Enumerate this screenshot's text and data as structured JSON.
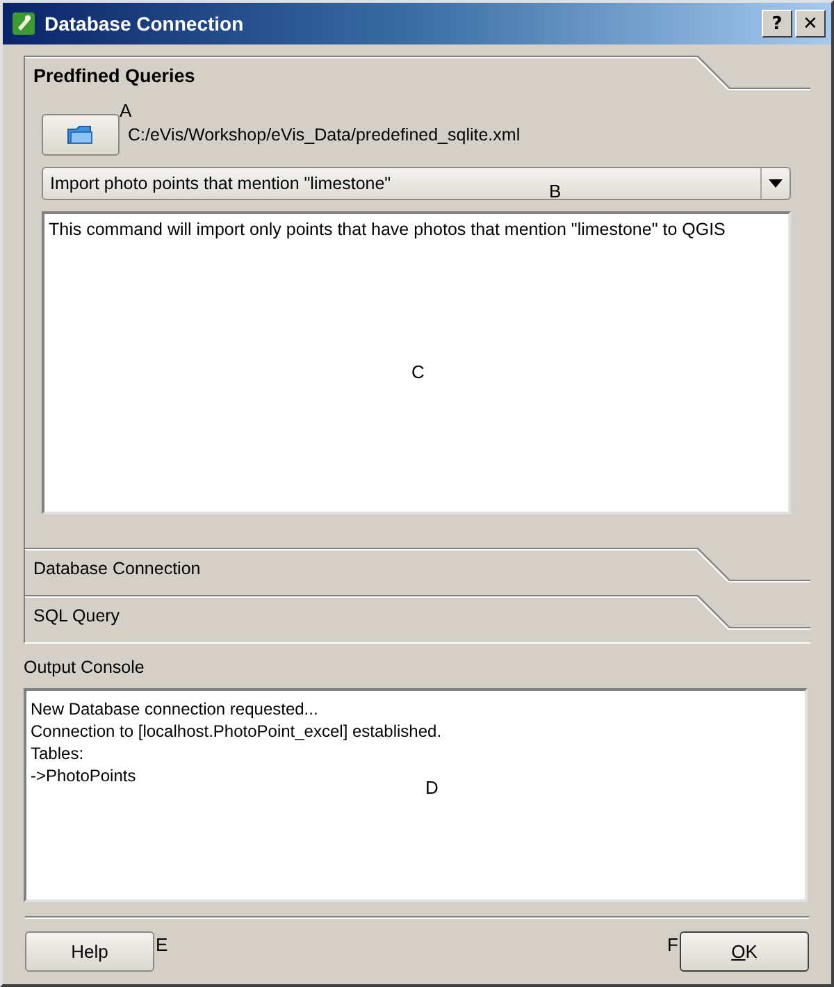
{
  "window": {
    "title": "Database Connection",
    "help_button": "?",
    "close_button": "✕"
  },
  "toolbox": {
    "sections": [
      {
        "label": "Predfined Queries",
        "expanded": true,
        "file_path": "C:/eVis/Workshop/eVis_Data/predefined_sqlite.xml",
        "query": "Import photo points that mention \"limestone\"",
        "description": "This command will import only points that have photos that mention \"limestone\" to QGIS"
      },
      {
        "label": "Database Connection",
        "expanded": false
      },
      {
        "label": "SQL Query",
        "expanded": false
      }
    ]
  },
  "output_console": {
    "label": "Output Console",
    "lines": [
      "New Database connection requested...",
      "Connection to [localhost.PhotoPoint_excel] established.",
      "Tables:",
      "->PhotoPoints"
    ]
  },
  "buttons": [
    {
      "label": "Help",
      "default": false,
      "shortcut_underlined": false
    },
    {
      "label": "OK",
      "default": true,
      "shortcut_underlined": true
    }
  ],
  "annotations": [
    "A",
    "B",
    "C",
    "D",
    "E",
    "F"
  ]
}
